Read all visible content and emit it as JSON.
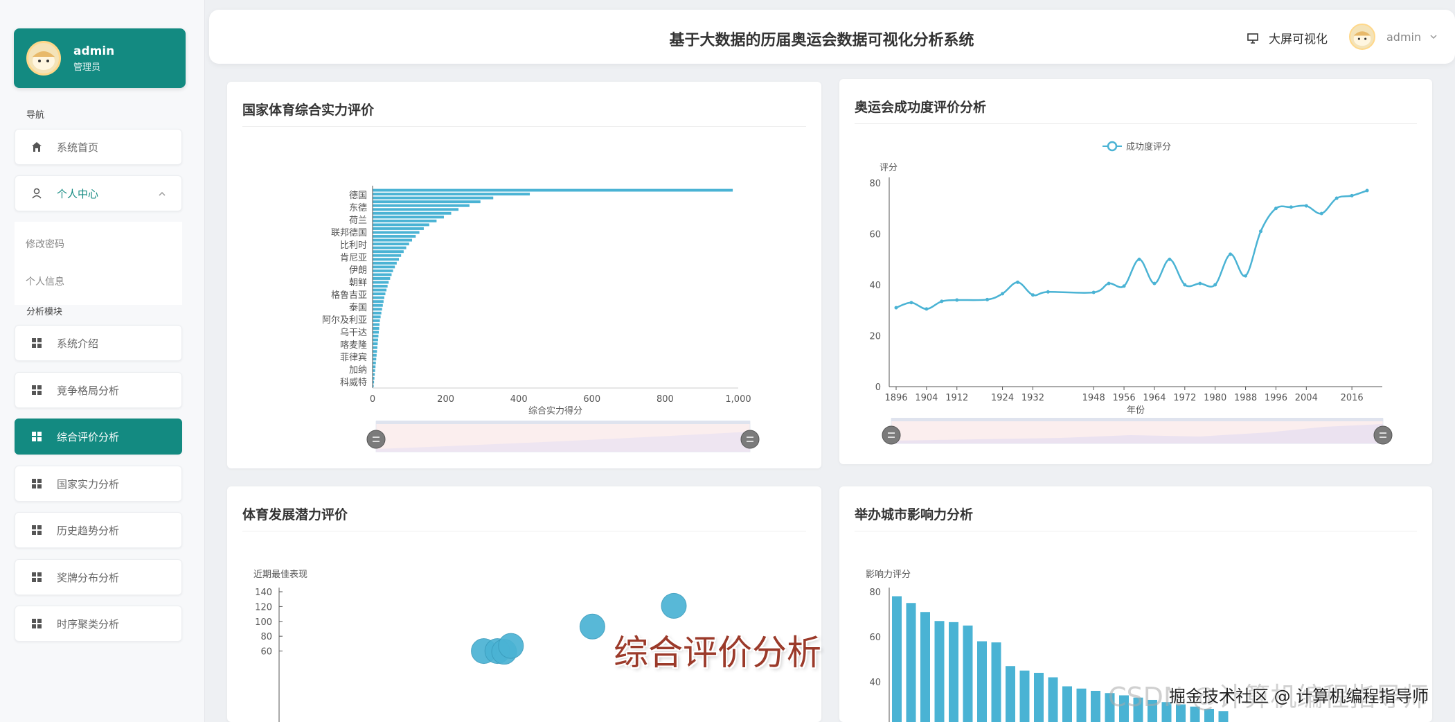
{
  "sidebar": {
    "user": {
      "name": "admin",
      "role": "管理员"
    },
    "nav_label": "导航",
    "home": "系统首页",
    "personal_center": "个人中心",
    "sub_items": [
      "修改密码",
      "个人信息"
    ],
    "module_label": "分析模块",
    "items": [
      {
        "label": "系统介绍"
      },
      {
        "label": "竞争格局分析"
      },
      {
        "label": "综合评价分析"
      },
      {
        "label": "国家实力分析"
      },
      {
        "label": "历史趋势分析"
      },
      {
        "label": "奖牌分布分析"
      },
      {
        "label": "时序聚类分析"
      }
    ]
  },
  "header": {
    "title": "基于大数据的历届奥运会数据可视化分析系统",
    "screen_link": "大屏可视化",
    "user": "admin"
  },
  "colors": {
    "accent": "#138a81",
    "series": "#4ab3d4"
  },
  "cards": {
    "strength": {
      "title": "国家体育综合实力评价"
    },
    "success": {
      "title": "奥运会成功度评价分析"
    },
    "potential": {
      "title": "体育发展潜力评价"
    },
    "city": {
      "title": "举办城市影响力分析"
    }
  },
  "chart_data": [
    {
      "type": "bar",
      "orientation": "horizontal",
      "xlabel": "综合实力得分",
      "xlim": [
        0,
        1000
      ],
      "x_ticks": [
        "0",
        "200",
        "400",
        "600",
        "800",
        "1,000"
      ],
      "visible_category_labels": [
        "德国",
        "东德",
        "荷兰",
        "联邦德国",
        "比利时",
        "肯尼亚",
        "伊朗",
        "朝鲜",
        "格鲁吉亚",
        "泰国",
        "阿尔及利亚",
        "乌干达",
        "喀麦隆",
        "菲律宾",
        "加纳",
        "科威特"
      ],
      "values": [
        985,
        430,
        330,
        295,
        265,
        235,
        215,
        195,
        175,
        155,
        140,
        128,
        118,
        108,
        100,
        92,
        85,
        78,
        72,
        66,
        61,
        56,
        52,
        48,
        44,
        41,
        38,
        35,
        32,
        30,
        28,
        26,
        24,
        22,
        20,
        19,
        18,
        17,
        16,
        15,
        14,
        13,
        12,
        11,
        10,
        9,
        8,
        7,
        6,
        5,
        4,
        3
      ],
      "datazoom": true
    },
    {
      "type": "line",
      "legend": "成功度评分",
      "legend_position": "top-center",
      "ylabel": "评分",
      "xlabel": "年份",
      "ylim": [
        0,
        80
      ],
      "y_ticks": [
        0,
        20,
        40,
        60,
        80
      ],
      "x_ticks": [
        "1896",
        "1904",
        "1912",
        "1924",
        "1932",
        "1948",
        "1956",
        "1964",
        "1972",
        "1980",
        "1988",
        "1996",
        "2004",
        "2016"
      ],
      "x": [
        1896,
        1900,
        1904,
        1908,
        1912,
        1920,
        1924,
        1928,
        1932,
        1936,
        1948,
        1952,
        1956,
        1960,
        1964,
        1968,
        1972,
        1976,
        1980,
        1984,
        1988,
        1992,
        1996,
        2000,
        2004,
        2008,
        2012,
        2016,
        2020
      ],
      "values": [
        31,
        33,
        30.5,
        33.5,
        34,
        34.2,
        36.5,
        41,
        36,
        37.2,
        37,
        40.5,
        39.5,
        50,
        40.5,
        50,
        40,
        40.5,
        40,
        52,
        43.5,
        61,
        70,
        70.5,
        71,
        68,
        74,
        75,
        77
      ],
      "datazoom": true
    },
    {
      "type": "scatter",
      "ylabel": "近期最佳表现",
      "ylim": [
        60,
        140
      ],
      "y_ticks": [
        60,
        80,
        100,
        120,
        140
      ],
      "points": [
        {
          "x": 11,
          "y": 60
        },
        {
          "x": 12,
          "y": 60
        },
        {
          "x": 12.5,
          "y": 59
        },
        {
          "x": 13,
          "y": 67
        },
        {
          "x": 19,
          "y": 93
        },
        {
          "x": 25,
          "y": 121
        }
      ]
    },
    {
      "type": "bar",
      "ylabel": "影响力评分",
      "ylim": [
        0,
        80
      ],
      "y_ticks": [
        40,
        60,
        80
      ],
      "values": [
        78,
        75,
        71,
        67,
        66.5,
        65,
        58,
        57.5,
        47,
        45,
        44,
        42,
        38,
        37,
        36,
        35,
        34,
        33,
        32,
        31,
        30,
        29,
        28,
        27
      ]
    }
  ],
  "overlay": {
    "caption": "综合评价分析",
    "watermark": "CSDN @计算机编程指导师",
    "watermark2": "掘金技术社区 @ 计算机编程指导师"
  }
}
